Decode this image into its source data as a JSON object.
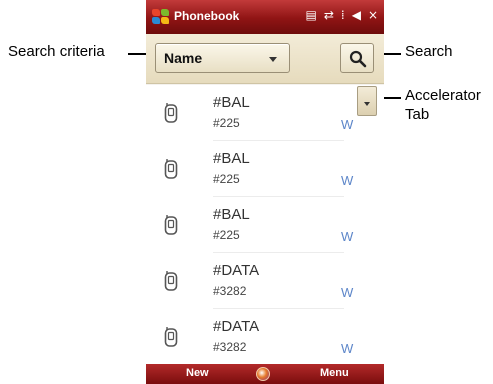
{
  "callouts": {
    "search_criteria": "Search criteria",
    "search": "Search",
    "accelerator_tab_line1": "Accelerator",
    "accelerator_tab_line2": "Tab"
  },
  "titlebar": {
    "title": "Phonebook",
    "status_icons": [
      "sim-card-icon",
      "sync-arrows-icon",
      "signal-icon",
      "speaker-icon",
      "close-icon"
    ],
    "status_glyphs": [
      "▤",
      "⇄",
      "⁞",
      "◀",
      "×"
    ]
  },
  "search": {
    "criteria_value": "Name",
    "button_icon": "search-icon"
  },
  "contacts": [
    {
      "name": "#BAL",
      "number": "#225",
      "type": "W"
    },
    {
      "name": "#BAL",
      "number": "#225",
      "type": "W"
    },
    {
      "name": "#BAL",
      "number": "#225",
      "type": "W"
    },
    {
      "name": "#DATA",
      "number": "#3282",
      "type": "W"
    },
    {
      "name": "#DATA",
      "number": "#3282",
      "type": "W"
    }
  ],
  "bottombar": {
    "left_softkey": "New",
    "right_softkey": "Menu"
  },
  "colors": {
    "titlebar": "#8f1414",
    "searchbar": "#e6dbbd",
    "type_label": "#5d86c9"
  }
}
